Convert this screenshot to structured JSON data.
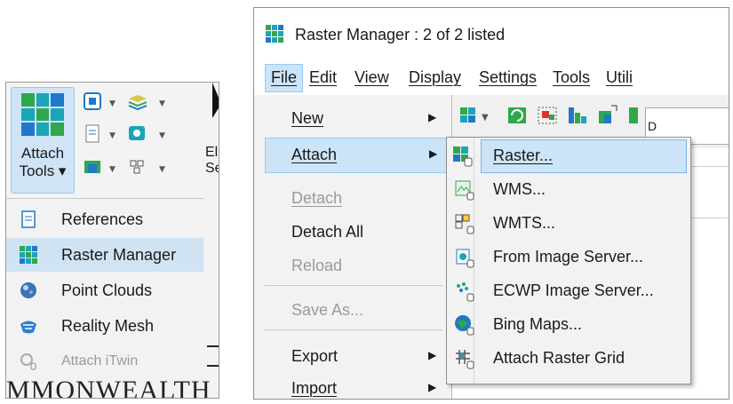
{
  "left_panel": {
    "attach_tools_label_line1": "Attach",
    "attach_tools_label_line2": "Tools ▾",
    "element_selection_partial_line1": "Elen",
    "element_selection_partial_line2": "Selec",
    "menu_items": [
      {
        "label": "References",
        "icon": "references-icon",
        "state": "normal"
      },
      {
        "label": "Raster Manager",
        "icon": "raster-manager-icon",
        "state": "selected"
      },
      {
        "label": "Point Clouds",
        "icon": "point-clouds-icon",
        "state": "normal"
      },
      {
        "label": "Reality Mesh",
        "icon": "reality-mesh-icon",
        "state": "normal"
      },
      {
        "label": "Attach iTwin",
        "icon": "attach-itwin-icon",
        "state": "disabled"
      }
    ],
    "document_text": "MMONWEALTH"
  },
  "window": {
    "title": "Raster Manager : 2 of 2 listed",
    "menubar": [
      {
        "label": "File",
        "active": true
      },
      {
        "label": "Edit"
      },
      {
        "label": "View"
      },
      {
        "label": "Display"
      },
      {
        "label": "Settings"
      },
      {
        "label": "Tools"
      },
      {
        "label": "Utili"
      }
    ],
    "file_menu": [
      {
        "label": "New",
        "submenu": true
      },
      {
        "label": "Attach",
        "submenu": true,
        "highlighted": true
      },
      {
        "label": "Detach",
        "disabled": true
      },
      {
        "label": "Detach All"
      },
      {
        "label": "Reload",
        "disabled": true
      },
      {
        "label": "Save As...",
        "disabled": true
      },
      {
        "label": "Export",
        "submenu": true
      },
      {
        "label": "Import",
        "submenu": true
      }
    ],
    "attach_submenu": [
      {
        "label": "Raster...",
        "icon": "raster-file-icon",
        "highlighted": true
      },
      {
        "label": "WMS...",
        "icon": "wms-icon"
      },
      {
        "label": "WMTS...",
        "icon": "wmts-icon"
      },
      {
        "label": "From Image Server...",
        "icon": "image-server-icon"
      },
      {
        "label": "ECWP Image Server...",
        "icon": "ecwp-server-icon"
      },
      {
        "label": "Bing Maps...",
        "icon": "bing-maps-icon"
      },
      {
        "label": "Attach Raster Grid",
        "icon": "raster-grid-icon"
      }
    ],
    "toolbar_partial_text": "D"
  },
  "colors": {
    "selected_bg": "#cfe3f3",
    "highlight_bg": "#cce4f7",
    "highlight_border": "#99c9ef",
    "icon_green": "#2ea84a",
    "icon_blue": "#1f78c8",
    "icon_teal": "#1aa5b8"
  }
}
